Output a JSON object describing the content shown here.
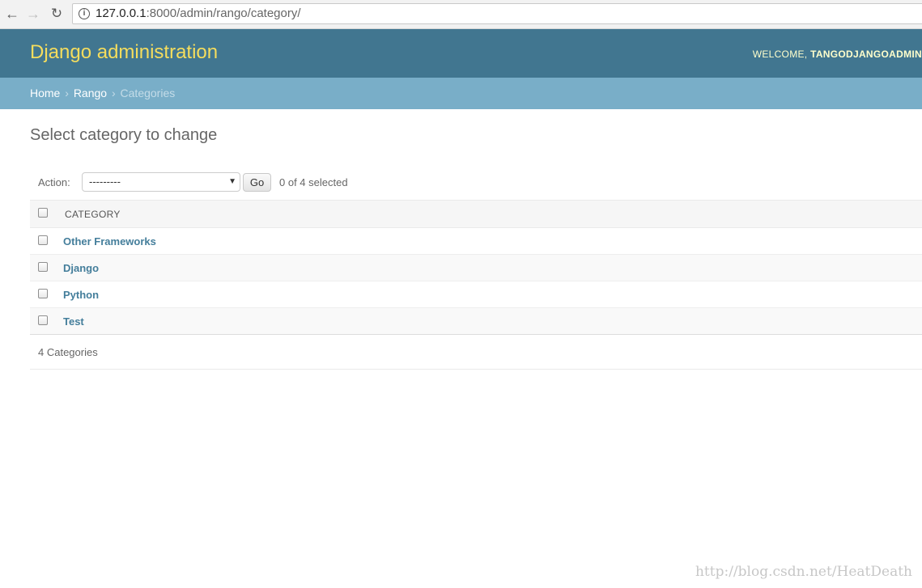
{
  "browser": {
    "url_host": "127.0.0.1",
    "url_rest": ":8000/admin/rango/category/"
  },
  "header": {
    "site_title": "Django administration",
    "welcome_label": "WELCOME,",
    "username": "TANGODJANGOADMIN"
  },
  "breadcrumbs": {
    "home": "Home",
    "app": "Rango",
    "current": "Categories",
    "separator": "›"
  },
  "content": {
    "title": "Select category to change"
  },
  "actions": {
    "label": "Action:",
    "selected_option": "---------",
    "go_label": "Go",
    "counter": "0 of 4 selected"
  },
  "table": {
    "column_header": "CATEGORY",
    "rows": [
      {
        "name": "Other Frameworks"
      },
      {
        "name": "Django"
      },
      {
        "name": "Python"
      },
      {
        "name": "Test"
      }
    ]
  },
  "paginator": {
    "text": "4 Categories"
  },
  "watermark": "http://blog.csdn.net/HeatDeath",
  "colors": {
    "header_bg": "#417690",
    "breadcrumb_bg": "#79aec8",
    "site_title": "#f5dd5d",
    "link": "#447e9b"
  }
}
